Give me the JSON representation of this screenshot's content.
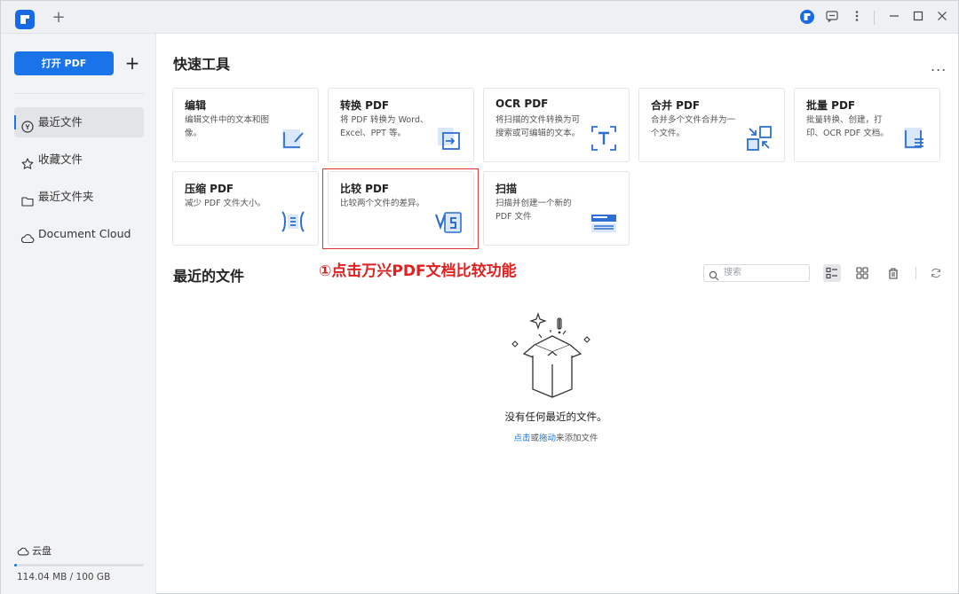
{
  "titlebar": {
    "new_tab": "+",
    "icons": [
      "app-logo-icon",
      "feedback-icon",
      "more-icon",
      "minimize-icon",
      "maximize-icon",
      "close-icon"
    ]
  },
  "sidebar": {
    "open_button": "打开 PDF",
    "add_button": "+",
    "items": [
      {
        "label": "最近文件",
        "icon": "clock-icon",
        "active": true
      },
      {
        "label": "收藏文件",
        "icon": "star-icon",
        "active": false
      },
      {
        "label": "最近文件夹",
        "icon": "folder-icon",
        "active": false
      },
      {
        "label": "Document Cloud",
        "icon": "cloud-icon",
        "active": false
      }
    ],
    "cloud_label": "云盘",
    "storage_text": "114.04 MB / 100 GB",
    "storage_used_fraction": 0.0011
  },
  "quick_tools": {
    "title": "快速工具",
    "more": "...",
    "cards": [
      {
        "title": "编辑",
        "desc": "编辑文件中的文本和图像。",
        "icon": "edit-icon"
      },
      {
        "title": "转换 PDF",
        "desc": "将 PDF 转换为 Word、Excel、PPT 等。",
        "icon": "convert-icon"
      },
      {
        "title": "OCR PDF",
        "desc": "将扫描的文件转换为可搜索或可编辑的文本。",
        "icon": "ocr-icon"
      },
      {
        "title": "合并 PDF",
        "desc": "合并多个文件合并为一个文件。",
        "icon": "combine-icon"
      },
      {
        "title": "批量 PDF",
        "desc": "批量转换、创建，打印、OCR PDF 文档。",
        "icon": "batch-icon"
      },
      {
        "title": "压缩 PDF",
        "desc": "减少 PDF 文件大小。",
        "icon": "compress-icon"
      },
      {
        "title": "比较 PDF",
        "desc": "比较两个文件的差异。",
        "icon": "compare-icon"
      },
      {
        "title": "扫描",
        "desc": "扫描并创建一个新的 PDF 文件",
        "icon": "scan-icon"
      }
    ]
  },
  "annotation": "①点击万兴PDF文档比较功能",
  "recent": {
    "title": "最近的文件",
    "search_placeholder": "搜索",
    "empty_title": "没有任何最近的文件。",
    "empty_link_click": "点击",
    "empty_or": "或",
    "empty_link_drag": "拖动",
    "empty_suffix": "来添加文件"
  },
  "colors": {
    "accent": "#1a73e8",
    "annotation": "#e02020"
  }
}
